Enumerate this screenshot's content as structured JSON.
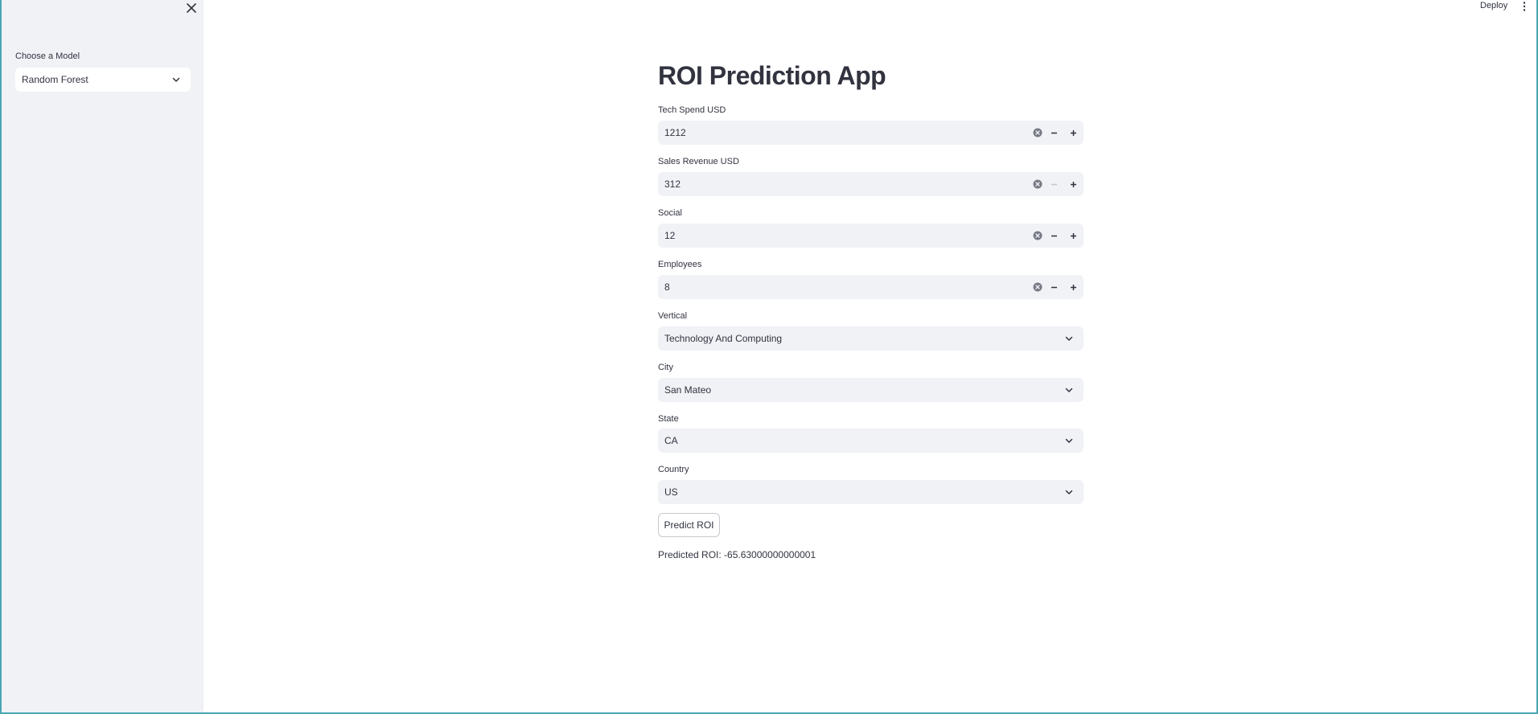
{
  "sidebar": {
    "model_label": "Choose a Model",
    "model_value": "Random Forest"
  },
  "header": {
    "deploy_label": "Deploy"
  },
  "main": {
    "title": "ROI Prediction App",
    "fields": {
      "tech_spend": {
        "label": "Tech Spend USD",
        "value": "1212"
      },
      "sales_revenue": {
        "label": "Sales Revenue USD",
        "value": "312"
      },
      "social": {
        "label": "Social",
        "value": "12"
      },
      "employees": {
        "label": "Employees",
        "value": "8"
      }
    },
    "selects": {
      "vertical": {
        "label": "Vertical",
        "value": "Technology And Computing"
      },
      "city": {
        "label": "City",
        "value": "San Mateo"
      },
      "state": {
        "label": "State",
        "value": "CA"
      },
      "country": {
        "label": "Country",
        "value": "US"
      }
    },
    "predict_button_label": "Predict ROI",
    "result_text": "Predicted ROI: -65.63000000000001"
  },
  "icons": {
    "close": "close-icon",
    "chevron": "chevron-down-icon",
    "menu": "kebab-menu-icon",
    "clear": "clear-circle-icon",
    "minus": "minus-icon",
    "plus": "plus-icon"
  },
  "colors": {
    "sidebar_bg": "#f0f2f6",
    "input_bg": "#f0f2f6",
    "text": "#31333f",
    "frame_border": "#4aa6b3"
  }
}
